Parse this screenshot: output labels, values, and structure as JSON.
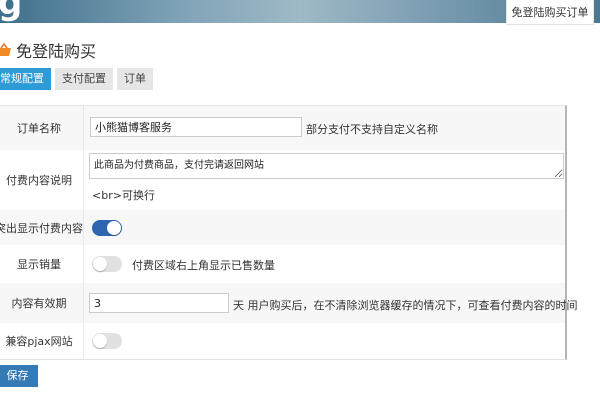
{
  "banner": {
    "logo_text": "g"
  },
  "top_tab": {
    "label": "免登陆购买订单"
  },
  "page": {
    "title": "免登陆购买"
  },
  "tabs": [
    {
      "label": "常规配置",
      "active": true
    },
    {
      "label": "支付配置",
      "active": false
    },
    {
      "label": "订单",
      "active": false
    }
  ],
  "form": {
    "order_name": {
      "label": "订单名称",
      "value": "小熊猫博客服务",
      "hint": "部分支付不支持自定义名称"
    },
    "pay_description": {
      "label": "付费内容说明",
      "value": "此商品为付费商品，支付完请返回网站",
      "hint": "<br>可换行"
    },
    "highlight_paid": {
      "label": "突出显示付费内容",
      "on": true
    },
    "show_sales": {
      "label": "显示销量",
      "on": false,
      "hint": "付费区域右上角显示已售数量"
    },
    "validity": {
      "label": "内容有效期",
      "value": "3",
      "hint": "天 用户购买后，在不清除浏览器缓存的情况下，可查看付费内容的时间"
    },
    "pjax": {
      "label": "兼容pjax网站",
      "on": false
    }
  },
  "save_button": {
    "label": "保存"
  },
  "colors": {
    "accent": "#2e9bd6",
    "toggle_on": "#2f65b0",
    "save": "#337ab7"
  }
}
